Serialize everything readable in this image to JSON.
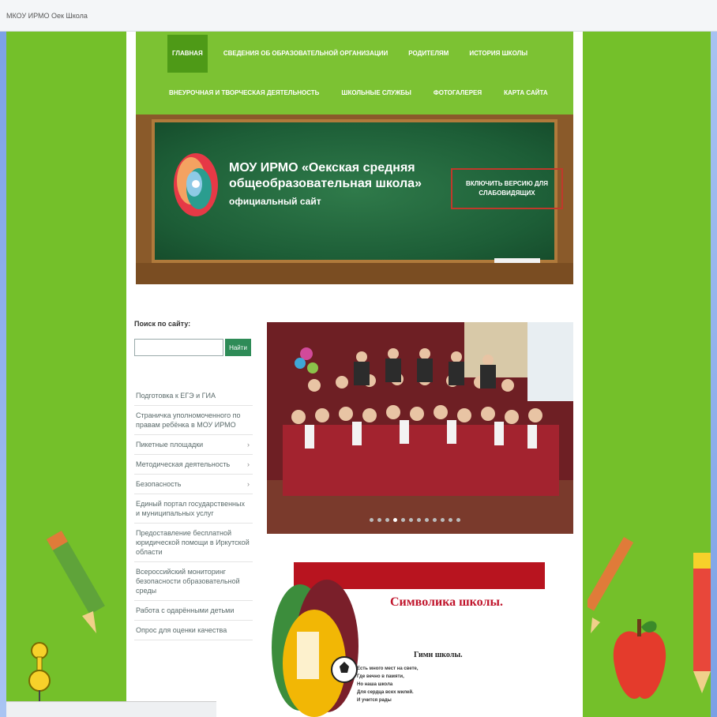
{
  "browser": {
    "title": "МКОУ ИРМО Оек Школа"
  },
  "nav": {
    "row1": [
      {
        "label": "Главная",
        "active": true
      },
      {
        "label": "Сведения об образовательной организации",
        "active": false
      },
      {
        "label": "Родителям",
        "active": false
      },
      {
        "label": "История школы",
        "active": false
      }
    ],
    "row2": [
      {
        "label": "Внеурочная и творческая деятельность",
        "active": false
      },
      {
        "label": "Школьные службы",
        "active": false
      },
      {
        "label": "Фотогалерея",
        "active": false
      },
      {
        "label": "Карта сайта",
        "active": false
      }
    ]
  },
  "header": {
    "school_name": "МОУ ИРМО «Оекская средняя общеобразовательная школа»",
    "site_label": "официальный сайт",
    "vision_button": "Включить версию для слабовидящих"
  },
  "sidebar": {
    "search_label": "Поиск по сайту:",
    "search_placeholder": "",
    "search_button": "Найти",
    "items": [
      {
        "label": "Подготовка к ЕГЭ и ГИА",
        "has_arrow": false
      },
      {
        "label": "Страничка уполномоченного по правам ребёнка в МОУ ИРМО",
        "has_arrow": false
      },
      {
        "label": "Пикетные площадки",
        "has_arrow": true
      },
      {
        "label": "Методическая деятельность",
        "has_arrow": true
      },
      {
        "label": "Безопасность",
        "has_arrow": true
      },
      {
        "label": "Единый портал государственных и муниципальных услуг",
        "has_arrow": false
      },
      {
        "label": "Предоставление бесплатной юридической помощи в Иркутской области",
        "has_arrow": false
      },
      {
        "label": "Всероссийский мониторинг безопасности образовательной среды",
        "has_arrow": false
      },
      {
        "label": "Работа с одарёнными детьми",
        "has_arrow": false
      },
      {
        "label": "Опрос для оценки качества",
        "has_arrow": false
      }
    ]
  },
  "slider": {
    "dot_count": 12,
    "active_dot": 3
  },
  "symbols": {
    "title": "Символика школы.",
    "anthem_title": "Гимн школы.",
    "anthem_lines": [
      "Есть много мест на свете,",
      "Где вечно в памяти,",
      "Но наша школа",
      "Для сердца всех милей.",
      "И учится рады"
    ]
  },
  "colors": {
    "accent_green": "#7cc233",
    "active_nav": "#4e9a17",
    "board_green": "#1d5e37",
    "wood": "#8a5a2a",
    "button_border": "#c0392b",
    "symbol_red": "#b8141f"
  },
  "icons": {
    "decor_left": [
      "pencil-icon",
      "pushpin-icon"
    ],
    "decor_right": [
      "pencil-icon",
      "apple-icon",
      "pencil-icon"
    ],
    "menu_arrow": "chevron-right-icon"
  }
}
